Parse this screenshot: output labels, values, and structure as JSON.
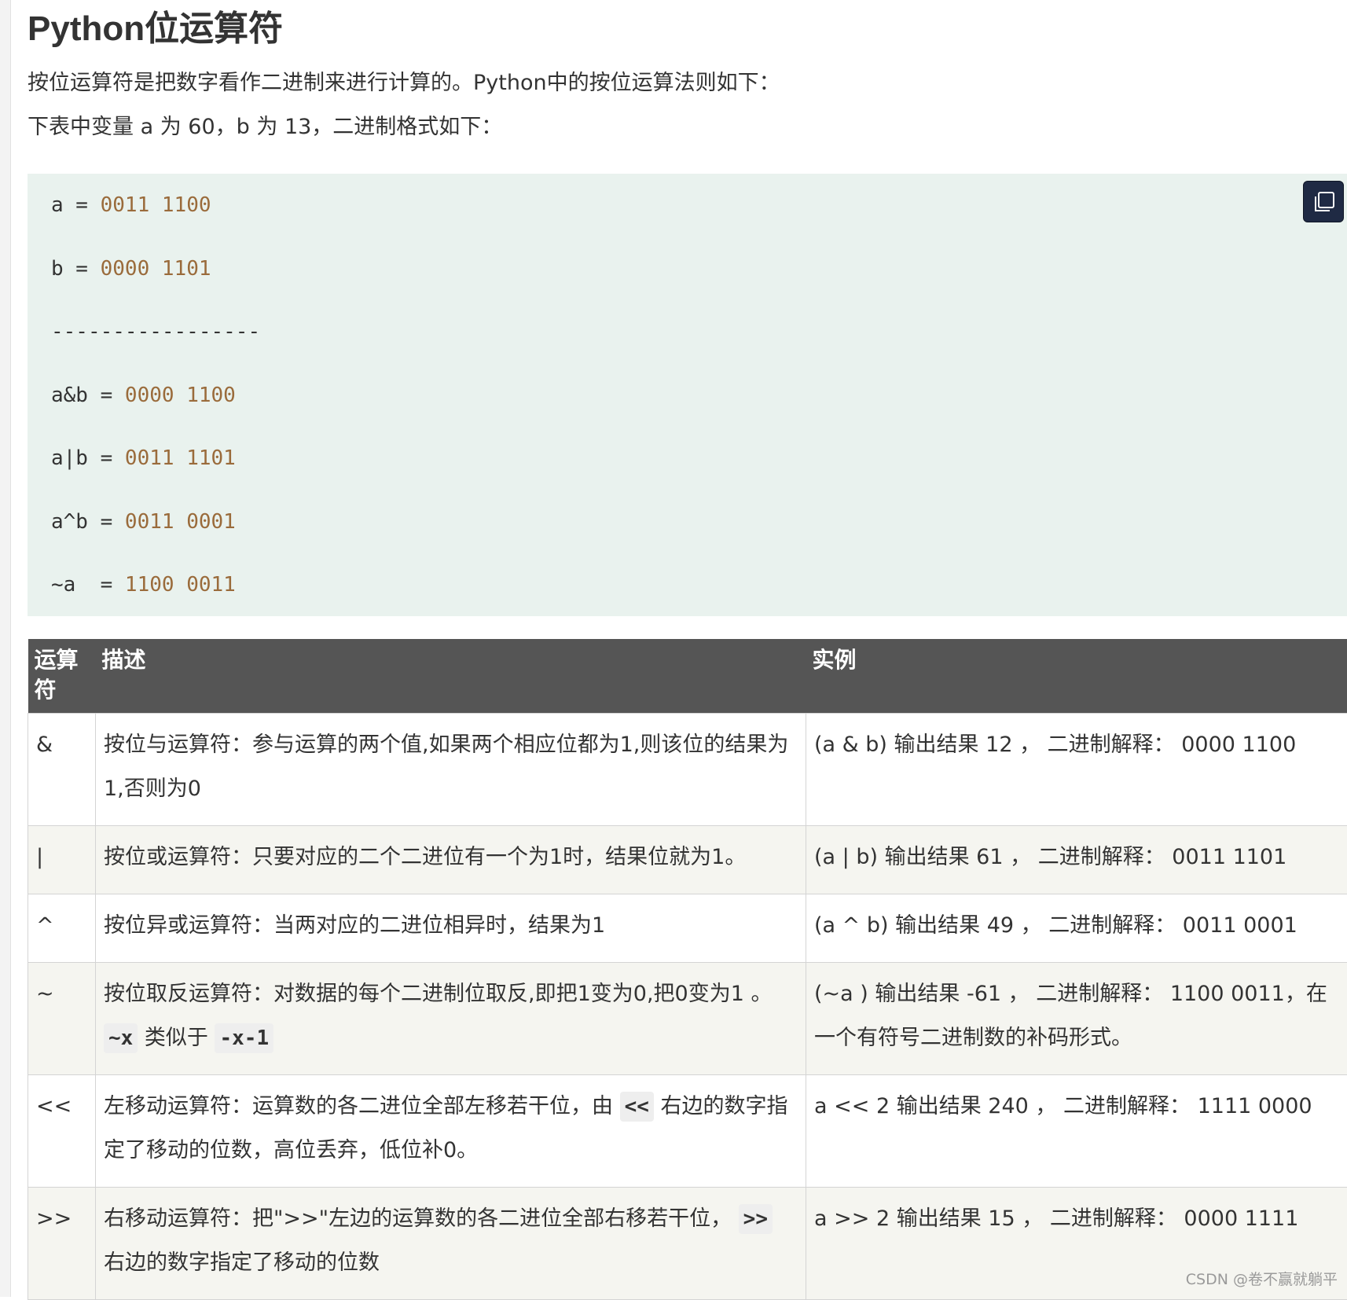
{
  "page": {
    "title": "Python位运算符",
    "intro": "按位运算符是把数字看作二进制来进行计算的。Python中的按位运算法则如下：",
    "vars_note": "下表中变量 a 为 60，b 为 13，二进制格式如下："
  },
  "code": {
    "copy_icon": "copy-icon",
    "lines": [
      {
        "lhs": "a = ",
        "num": "0011 1100"
      },
      {
        "lhs": "b = ",
        "num": "0000 1101"
      },
      {
        "lhs": "-----------------",
        "num": ""
      },
      {
        "lhs": "a&b = ",
        "num": "0000 1100"
      },
      {
        "lhs": "a|b = ",
        "num": "0011 1101"
      },
      {
        "lhs": "a^b = ",
        "num": "0011 0001"
      },
      {
        "lhs": "~a  = ",
        "num": "1100 0011"
      }
    ]
  },
  "table": {
    "headers": {
      "operator": "运算符",
      "description": "描述",
      "example": "实例"
    },
    "rows": [
      {
        "op": "&",
        "desc": "按位与运算符：参与运算的两个值,如果两个相应位都为1,则该位的结果为1,否则为0",
        "example": "(a & b) 输出结果 12 ， 二进制解释： 0000 1100"
      },
      {
        "op": "|",
        "desc": "按位或运算符：只要对应的二个二进位有一个为1时，结果位就为1。",
        "example": "(a | b) 输出结果 61 ， 二进制解释： 0011 1101"
      },
      {
        "op": "^",
        "desc": "按位异或运算符：当两对应的二进位相异时，结果为1",
        "example": "(a ^ b) 输出结果 49 ， 二进制解释： 0011 0001"
      },
      {
        "op": "~",
        "desc": "按位取反运算符：对数据的每个二进制位取反,即把1变为0,把0变为1 。",
        "desc_code_1": "~x",
        "desc_mid": " 类似于 ",
        "desc_code_2": "-x-1",
        "example": "(~a ) 输出结果 -61 ， 二进制解释： 1100 0011，在一个有符号二进制数的补码形式。"
      },
      {
        "op": "<<",
        "desc_pre": "左移动运算符：运算数的各二进位全部左移若干位，由 ",
        "desc_code": "<<",
        "desc_post": " 右边的数字指定了移动的位数，高位丢弃，低位补0。",
        "example": "a << 2 输出结果 240 ， 二进制解释： 1111 0000"
      },
      {
        "op": ">>",
        "desc_pre": "右移动运算符：把\">>\"左边的运算数的各二进位全部右移若干位， ",
        "desc_code": ">>",
        "desc_post": " 右边的数字指定了移动的位数",
        "example": "a >> 2 输出结果 15 ， 二进制解释： 0000 1111"
      }
    ]
  },
  "watermark": "CSDN @卷不赢就躺平"
}
